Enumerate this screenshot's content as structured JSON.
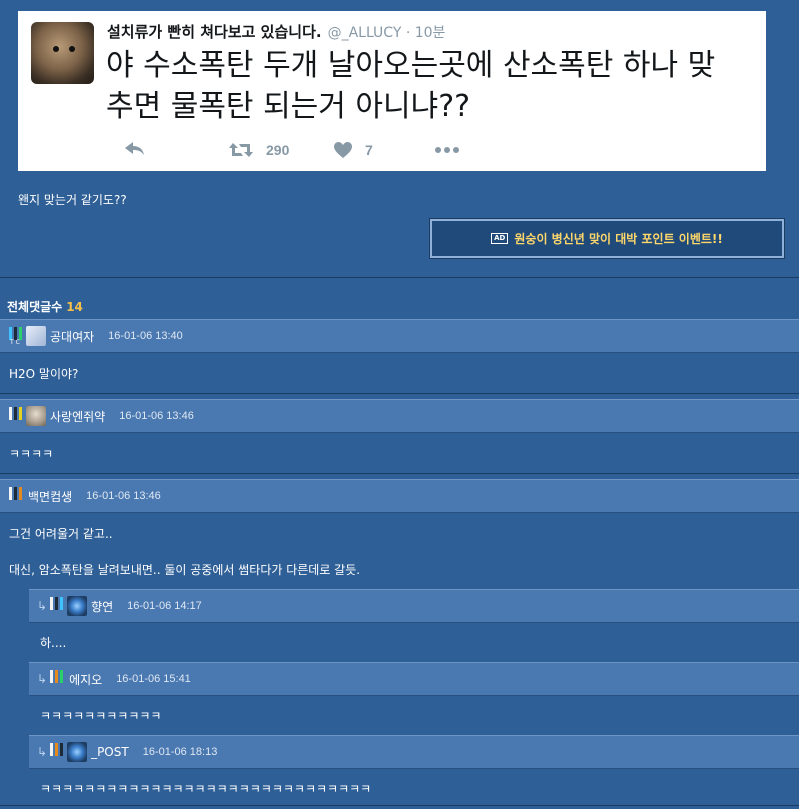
{
  "tweet": {
    "display_name": "설치류가 빤히 쳐다보고 있습니다.",
    "handle": "@_ALLUCY · 10분",
    "text_line1": "야 수소폭탄 두개 날아오는곳에 산소폭탄 하나 맞",
    "text_line2": "추면 물폭탄 되는거 아니냐??",
    "retweets": "290",
    "likes": "7",
    "icons": [
      "reply-icon",
      "retweet-icon",
      "heart-icon",
      "more-icon"
    ]
  },
  "post": {
    "intro_text": "왠지 맞는거 같기도??",
    "event_ad_label": "AD",
    "event_text": "원숭이 병신년 맞이 대박 포인트 이벤트!!"
  },
  "comments_header": {
    "label": "전체댓글수",
    "count": "14"
  },
  "comments": [
    {
      "nick": "공대여자",
      "date": "16-01-06 13:40",
      "body": "H2O 말이야?"
    },
    {
      "nick": "사랑엔쥐약",
      "date": "16-01-06 13:46",
      "body": "ㅋㅋㅋㅋ"
    },
    {
      "nick": "백면컴생",
      "date": "16-01-06 13:46",
      "body1": "그건 어려울거 같고..",
      "body2": "대신, 암소폭탄을 날려보내면.. 둘이 공중에서 썸타다가 다른데로 갈듯."
    }
  ],
  "replies": [
    {
      "arrow": "↳",
      "nick": "향연",
      "date": "16-01-06 14:17",
      "body": "하...."
    },
    {
      "arrow": "↳",
      "nick": "에지오",
      "date": "16-01-06 15:41",
      "body": "ㅋㅋㅋㅋㅋㅋㅋㅋㅋㅋㅋ"
    },
    {
      "arrow": "↳",
      "nick": "_POST",
      "date": "16-01-06 18:13",
      "body": "ㅋㅋㅋㅋㅋㅋㅋㅋㅋㅋㅋㅋㅋㅋㅋㅋㅋㅋㅋㅋㅋㅋㅋㅋㅋㅋㅋㅋㅋㅋ"
    }
  ],
  "colors": {
    "background": "#2f5f97",
    "comment_header": "#4a78b0",
    "accent_count": "#f5c04a",
    "event_text": "#ffd76a"
  }
}
